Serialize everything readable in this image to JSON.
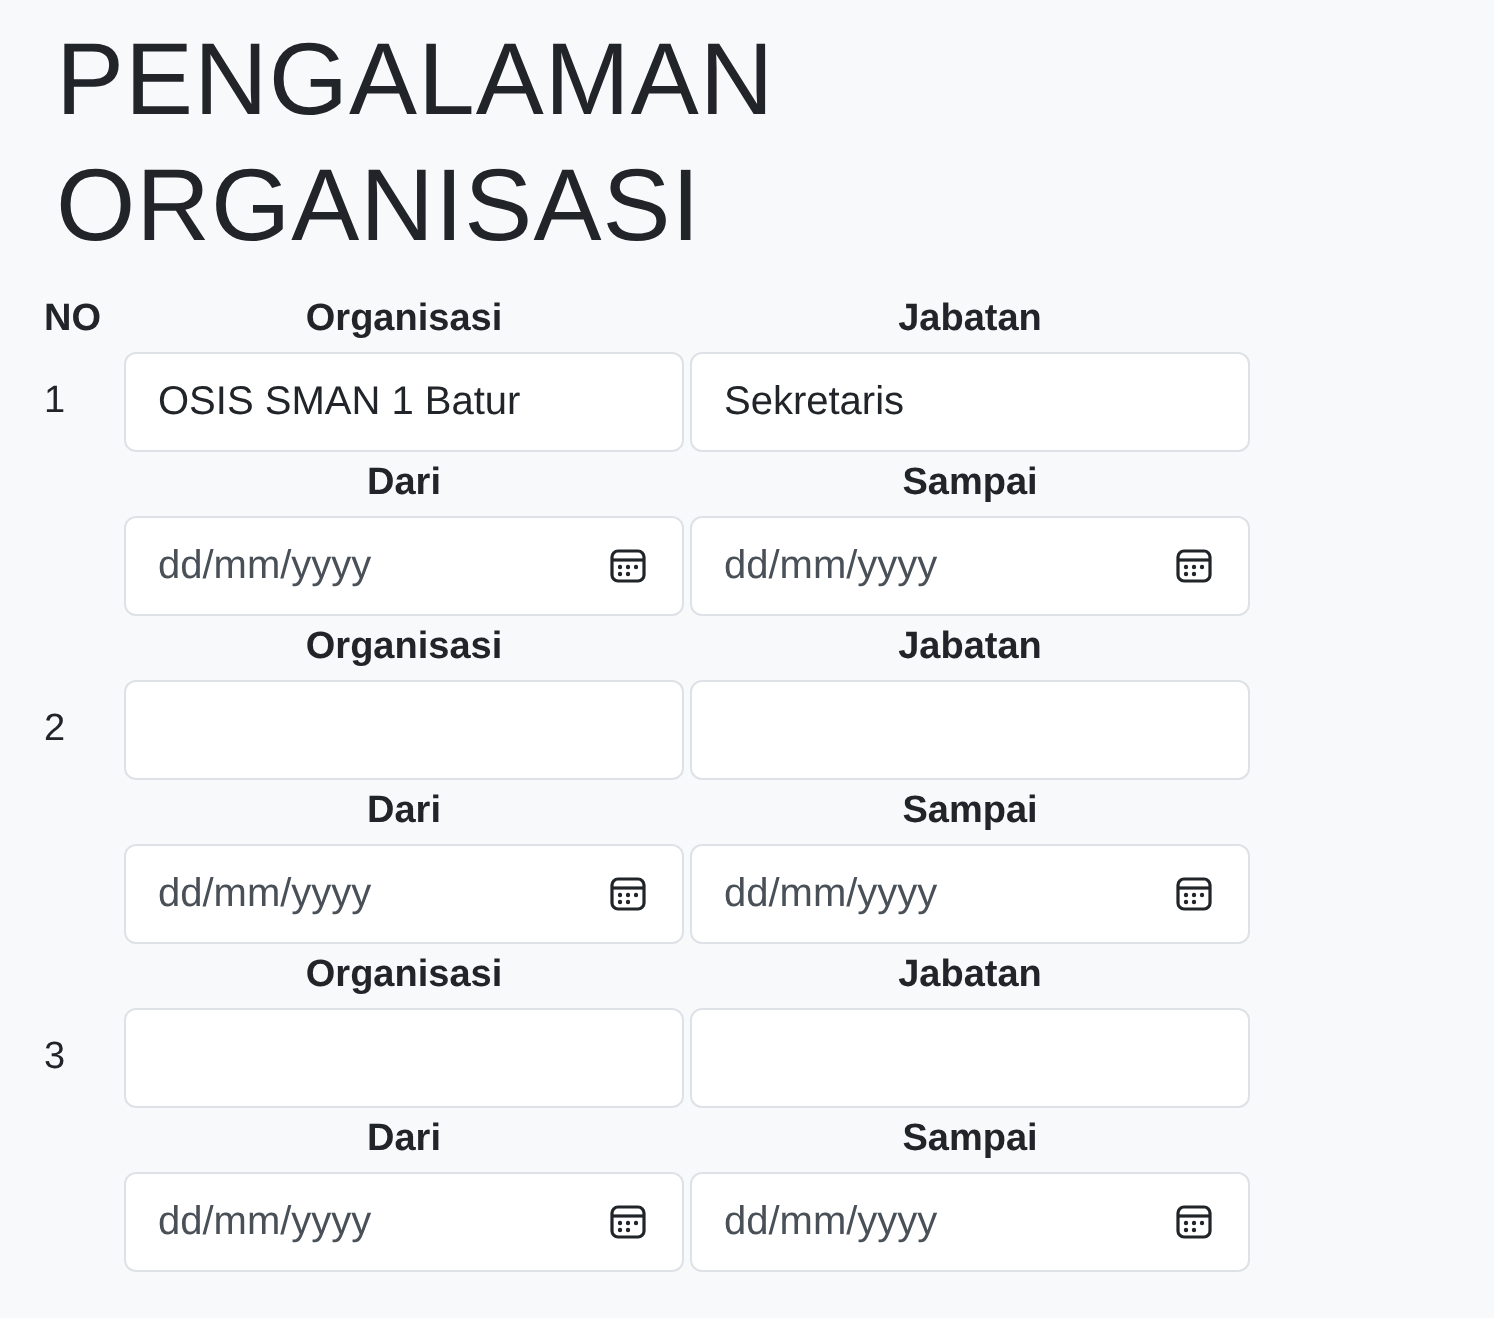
{
  "title": "PENGALAMAN ORGANISASI",
  "header": {
    "no": "NO",
    "organisasi": "Organisasi",
    "jabatan": "Jabatan"
  },
  "entries": [
    {
      "no": "1",
      "organisasi": {
        "value": "OSIS SMAN 1 Batur"
      },
      "jabatan": {
        "value": "Sekretaris"
      },
      "dari_label": "Dari",
      "sampai_label": "Sampai",
      "dari": {
        "placeholder": "dd/mm/yyyy"
      },
      "sampai": {
        "placeholder": "dd/mm/yyyy"
      }
    },
    {
      "no": "2",
      "organisasi_label": "Organisasi",
      "jabatan_label": "Jabatan",
      "dari_label": "Dari",
      "sampai_label": "Sampai",
      "dari": {
        "placeholder": "dd/mm/yyyy"
      },
      "sampai": {
        "placeholder": "dd/mm/yyyy"
      }
    },
    {
      "no": "3",
      "organisasi_label": "Organisasi",
      "jabatan_label": "Jabatan",
      "dari_label": "Dari",
      "sampai_label": "Sampai",
      "dari": {
        "placeholder": "dd/mm/yyyy"
      },
      "sampai": {
        "placeholder": "dd/mm/yyyy"
      }
    }
  ]
}
